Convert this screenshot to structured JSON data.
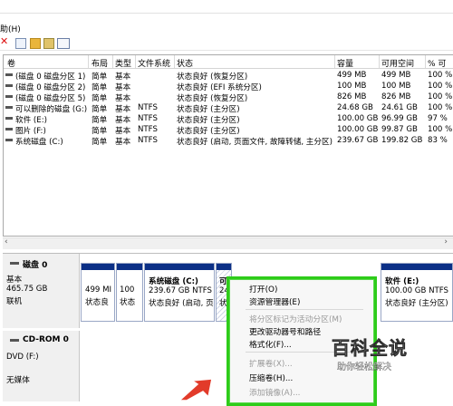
{
  "menu": {
    "help": "助(H)"
  },
  "columns": [
    "卷",
    "布局",
    "类型",
    "文件系统",
    "状态",
    "容量",
    "可用空间",
    "% 可"
  ],
  "volumes": [
    {
      "name": "(磁盘 0 磁盘分区 1)",
      "layout": "简单",
      "type": "基本",
      "fs": "",
      "status": "状态良好 (恢复分区)",
      "capacity": "499 MB",
      "free": "499 MB",
      "pct": "100 %"
    },
    {
      "name": "(磁盘 0 磁盘分区 2)",
      "layout": "简单",
      "type": "基本",
      "fs": "",
      "status": "状态良好 (EFI 系统分区)",
      "capacity": "100 MB",
      "free": "100 MB",
      "pct": "100 %"
    },
    {
      "name": "(磁盘 0 磁盘分区 5)",
      "layout": "简单",
      "type": "基本",
      "fs": "",
      "status": "状态良好 (恢复分区)",
      "capacity": "826 MB",
      "free": "826 MB",
      "pct": "100 %"
    },
    {
      "name": "可以删除的磁盘 (G:)",
      "layout": "简单",
      "type": "基本",
      "fs": "NTFS",
      "status": "状态良好 (主分区)",
      "capacity": "24.68 GB",
      "free": "24.61 GB",
      "pct": "100 %"
    },
    {
      "name": "软件 (E:)",
      "layout": "简单",
      "type": "基本",
      "fs": "NTFS",
      "status": "状态良好 (主分区)",
      "capacity": "100.00 GB",
      "free": "96.99 GB",
      "pct": "97 %"
    },
    {
      "name": "图片 (F:)",
      "layout": "简单",
      "type": "基本",
      "fs": "NTFS",
      "status": "状态良好 (主分区)",
      "capacity": "100.00 GB",
      "free": "99.87 GB",
      "pct": "100 %"
    },
    {
      "name": "系统磁盘 (C:)",
      "layout": "简单",
      "type": "基本",
      "fs": "NTFS",
      "status": "状态良好 (启动, 页面文件, 故障转储, 主分区)",
      "capacity": "239.67 GB",
      "free": "199.82 GB",
      "pct": "83 %"
    }
  ],
  "disk0": {
    "name": "磁盘 0",
    "type": "基本",
    "size": "465.75 GB",
    "state": "联机",
    "p1": {
      "l1": "499 MI",
      "l2": "状态良"
    },
    "p2": {
      "l1": "100",
      "l2": "状态"
    },
    "p3": {
      "l1": "系统磁盘 (C:)",
      "l2": "239.67 GB NTFS",
      "l3": "状态良好 (启动, 页"
    },
    "p4": {
      "l1": "可",
      "l2": "24",
      "l3": "状"
    },
    "p5": {
      "l1": "软件  (E:)",
      "l2": "100.00 GB NTFS",
      "l3": "状态良好 (主分区)"
    }
  },
  "cdrom": {
    "name": "CD-ROM 0",
    "type": "DVD (F:)",
    "media": "无媒体"
  },
  "context_menu": [
    {
      "label": "打开(O)",
      "enabled": true
    },
    {
      "label": "资源管理器(E)",
      "enabled": true
    },
    {
      "label": "将分区标记为活动分区(M)",
      "enabled": false
    },
    {
      "label": "更改驱动器号和路径",
      "enabled": true
    },
    {
      "label": "格式化(F)...",
      "enabled": true
    },
    {
      "label": "扩展卷(X)...",
      "enabled": false
    },
    {
      "label": "压缩卷(H)...",
      "enabled": true
    },
    {
      "label": "添加镜像(A)...",
      "enabled": false
    }
  ],
  "watermark": {
    "title": "百科全说",
    "subtitle": "助你轻松解决"
  },
  "colors": {
    "partition_header": "#0b2f86",
    "highlight_border": "#2ecc1a",
    "arrow": "#e23b2a"
  }
}
